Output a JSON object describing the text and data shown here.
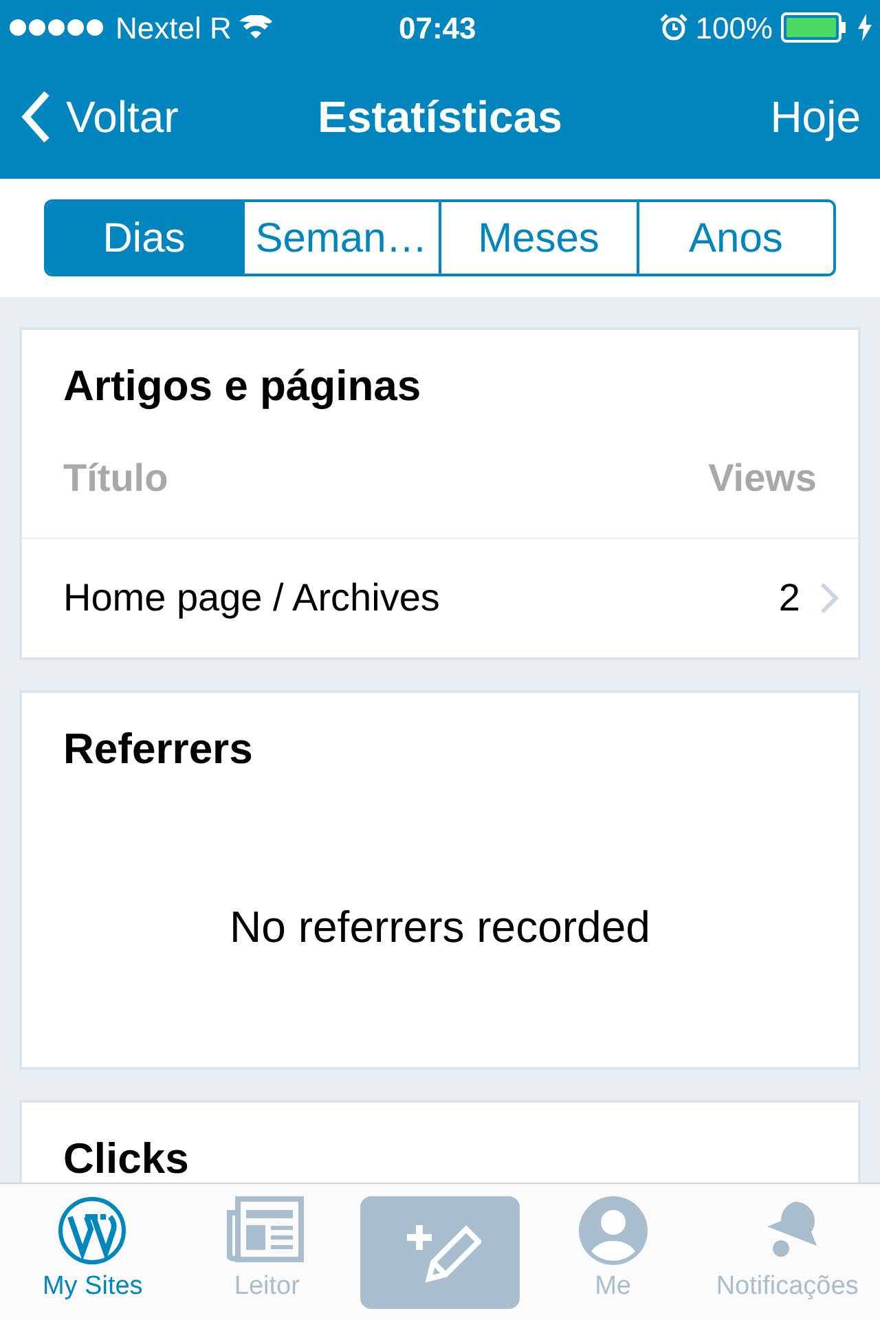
{
  "status_bar": {
    "carrier": "Nextel R",
    "time": "07:43",
    "battery": "100%"
  },
  "nav_bar": {
    "back": "Voltar",
    "title": "Estatísticas",
    "action": "Hoje"
  },
  "segments": [
    {
      "label": "Dias",
      "selected": true
    },
    {
      "label": "Seman…",
      "selected": false
    },
    {
      "label": "Meses",
      "selected": false
    },
    {
      "label": "Anos",
      "selected": false
    }
  ],
  "cards": [
    {
      "kind": "table",
      "title": "Artigos e páginas",
      "columns": [
        "Título",
        "Views"
      ],
      "rows": [
        {
          "title": "Home page / Archives",
          "views": "2"
        }
      ]
    },
    {
      "kind": "empty",
      "title": "Referrers",
      "message": "No referrers recorded"
    },
    {
      "kind": "empty",
      "title": "Clicks"
    }
  ],
  "tab_bar": [
    {
      "kind": "wordpress",
      "label": "My Sites",
      "selected": true
    },
    {
      "kind": "reader",
      "label": "Leitor",
      "selected": false
    },
    {
      "kind": "compose",
      "selected": false
    },
    {
      "kind": "me",
      "label": "Me",
      "selected": false
    },
    {
      "kind": "bell",
      "label": "Notificações",
      "selected": false
    }
  ]
}
